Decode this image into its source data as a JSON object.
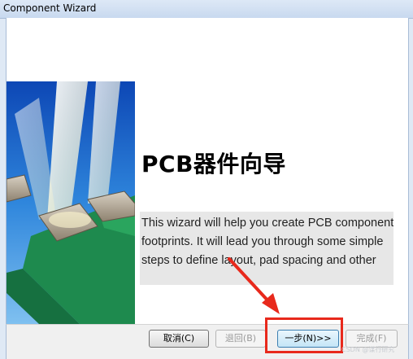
{
  "window": {
    "title": "Component Wizard"
  },
  "main": {
    "heading": "PCB器件向导",
    "description": "This wizard will help you create PCB component footprints. It will lead you through some simple steps to define layout, pad spacing and other"
  },
  "buttons": {
    "cancel": "取消(C)",
    "back": "退回(B)",
    "next": "一步(N)>>",
    "finish": "完成(F)"
  },
  "watermark": "CSDN @谋行研究",
  "colors": {
    "accent": "#e8291c",
    "pcb_green": "#1e8a4e",
    "sky_blue": "#2a7fd4"
  }
}
